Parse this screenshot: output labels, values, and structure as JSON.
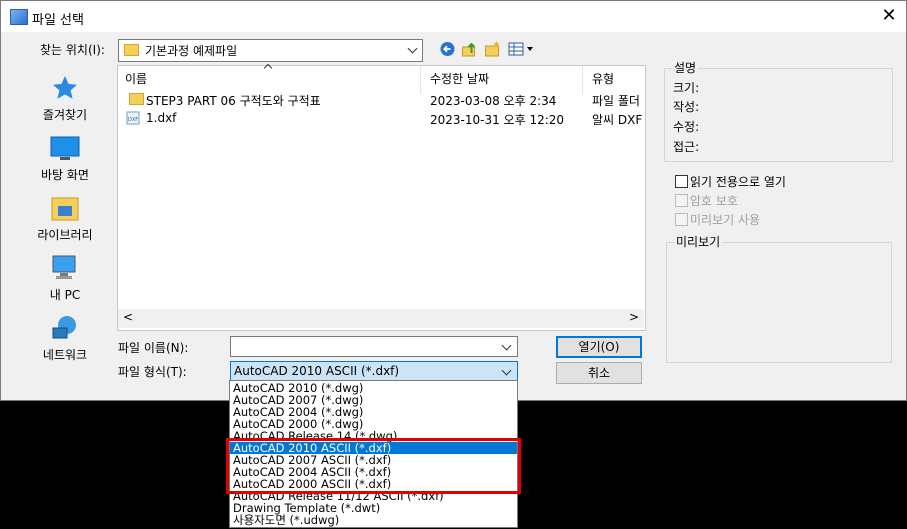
{
  "window": {
    "title": "파일 선택",
    "close_glyph": "✕"
  },
  "lookin": {
    "label": "찾는 위치(I):",
    "value": "기본과정 예제파일"
  },
  "places": [
    {
      "label": "즐겨찾기",
      "icon": "star-icon"
    },
    {
      "label": "바탕 화면",
      "icon": "desktop-icon"
    },
    {
      "label": "라이브러리",
      "icon": "library-icon"
    },
    {
      "label": "내 PC",
      "icon": "pc-icon"
    },
    {
      "label": "네트워크",
      "icon": "network-icon"
    }
  ],
  "toolbar_icons": [
    "back-icon",
    "up-folder-icon",
    "new-folder-icon",
    "views-icon"
  ],
  "filelist": {
    "columns": [
      "이름",
      "수정한 날짜",
      "유형"
    ],
    "rows": [
      {
        "name": "STEP3 PART 06 구적도와 구적표",
        "date": "2023-03-08 오후 2:34",
        "type": "파일 폴더",
        "icon": "folder-icon"
      },
      {
        "name": "1.dxf",
        "date": "2023-10-31 오후 12:20",
        "type": "알씨 DXF",
        "icon": "dxf-file-icon"
      }
    ]
  },
  "description": {
    "title": "설명",
    "fields": [
      "크기:",
      "작성:",
      "수정:",
      "접근:"
    ]
  },
  "options": {
    "readonly": "읽기 전용으로 열기",
    "password": "암호 보호",
    "preview_use": "미리보기 사용"
  },
  "preview": {
    "title": "미리보기"
  },
  "filename": {
    "label": "파일 이름(N):",
    "value": ""
  },
  "filetype": {
    "label": "파일 형식(T):",
    "value": "AutoCAD 2010 ASCII (*.dxf)",
    "options": [
      "AutoCAD 2010 (*.dwg)",
      "AutoCAD 2007 (*.dwg)",
      "AutoCAD 2004 (*.dwg)",
      "AutoCAD 2000 (*.dwg)",
      "AutoCAD Release 14 (*.dwg)",
      "AutoCAD 2010 ASCII (*.dxf)",
      "AutoCAD 2007 ASCII (*.dxf)",
      "AutoCAD 2004 ASCII (*.dxf)",
      "AutoCAD 2000 ASCII (*.dxf)",
      "AutoCAD Release 11/12 ASCII (*.dxf)",
      "Drawing Template (*.dwt)",
      "사용자도면 (*.udwg)"
    ],
    "selected_index": 5
  },
  "buttons": {
    "open": "열기(O)",
    "cancel": "취소"
  },
  "colors": {
    "accent": "#0078d7",
    "highlight_box": "#e00000"
  }
}
